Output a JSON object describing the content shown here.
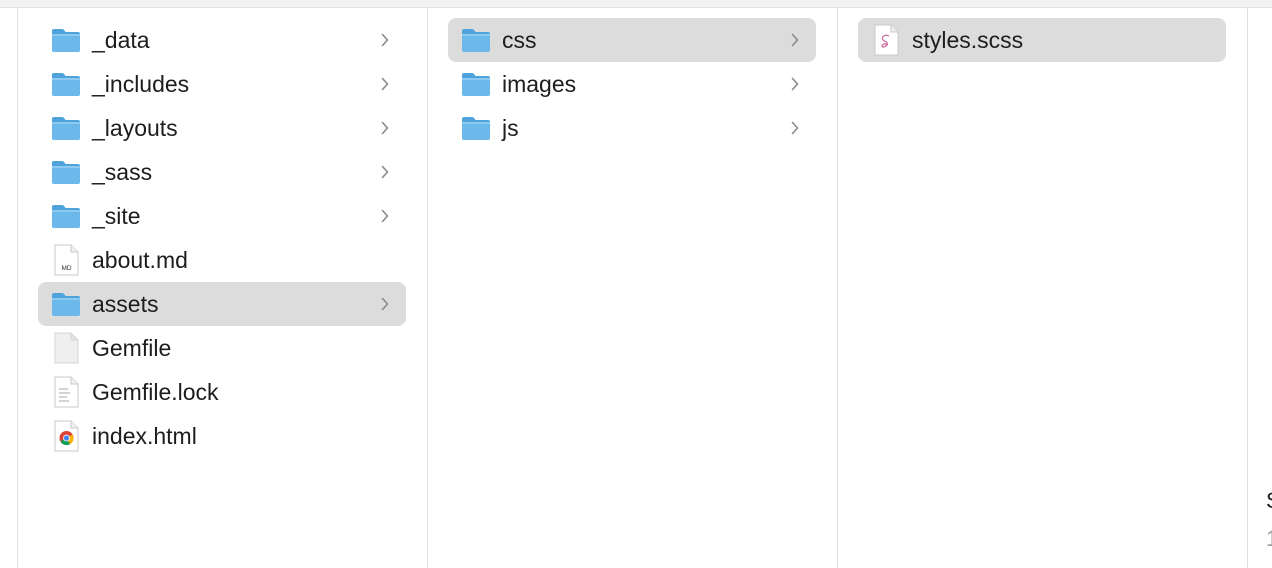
{
  "columns": [
    {
      "items": [
        {
          "label": "_data",
          "icon": "folder-icon",
          "selected": false,
          "chevron": true
        },
        {
          "label": "_includes",
          "icon": "folder-icon",
          "selected": false,
          "chevron": true
        },
        {
          "label": "_layouts",
          "icon": "folder-icon",
          "selected": false,
          "chevron": true
        },
        {
          "label": "_sass",
          "icon": "folder-icon",
          "selected": false,
          "chevron": true
        },
        {
          "label": "_site",
          "icon": "folder-icon",
          "selected": false,
          "chevron": true
        },
        {
          "label": "about.md",
          "icon": "markdown-file-icon",
          "icon_text": "MD",
          "selected": false,
          "chevron": false
        },
        {
          "label": "assets",
          "icon": "folder-icon",
          "selected": true,
          "chevron": true
        },
        {
          "label": "Gemfile",
          "icon": "blank-file-icon",
          "selected": false,
          "chevron": false
        },
        {
          "label": "Gemfile.lock",
          "icon": "text-file-icon",
          "selected": false,
          "chevron": false
        },
        {
          "label": "index.html",
          "icon": "chrome-html-file-icon",
          "selected": false,
          "chevron": false
        }
      ]
    },
    {
      "items": [
        {
          "label": "css",
          "icon": "folder-icon",
          "selected": true,
          "chevron": true
        },
        {
          "label": "images",
          "icon": "folder-icon",
          "selected": false,
          "chevron": true
        },
        {
          "label": "js",
          "icon": "folder-icon",
          "selected": false,
          "chevron": true
        }
      ]
    },
    {
      "items": [
        {
          "label": "styles.scss",
          "icon": "sass-file-icon",
          "selected": true,
          "chevron": false
        }
      ]
    }
  ],
  "preview_sliver": {
    "line1": "S",
    "line2": "1"
  },
  "colors": {
    "selection": "#dcdcdc",
    "folder_body": "#6cb8ea",
    "folder_tab": "#4ea3dd",
    "chevron": "#8a8a8a"
  }
}
